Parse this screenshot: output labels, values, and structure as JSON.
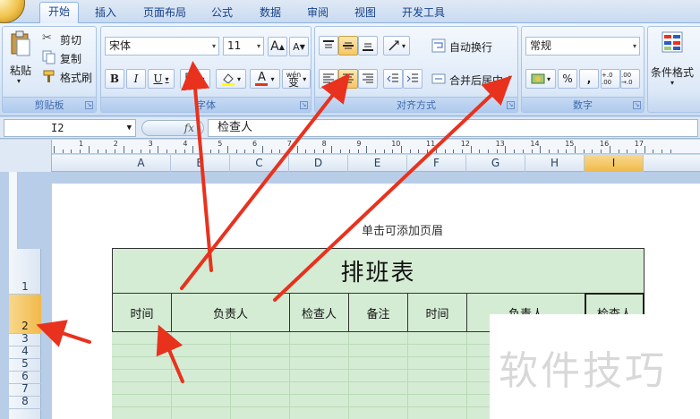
{
  "tabs": [
    {
      "label": "开始",
      "active": true
    },
    {
      "label": "插入"
    },
    {
      "label": "页面布局"
    },
    {
      "label": "公式"
    },
    {
      "label": "数据"
    },
    {
      "label": "审阅"
    },
    {
      "label": "视图"
    },
    {
      "label": "开发工具"
    }
  ],
  "clipboard": {
    "paste": "粘贴",
    "cut": "剪切",
    "copy": "复制",
    "format_painter": "格式刷",
    "group_label": "剪贴板"
  },
  "font": {
    "name": "宋体",
    "size": "11",
    "grow": "A",
    "shrink": "A",
    "bold": "B",
    "italic": "I",
    "underline": "U",
    "font_color": "A",
    "phonetic": "wén",
    "phonetic_char": "变",
    "group_label": "字体"
  },
  "alignment": {
    "wrap_text": "自动换行",
    "merge_center": "合并后居中",
    "group_label": "对齐方式"
  },
  "number": {
    "format": "常规",
    "percent": "%",
    "comma": ",",
    "inc_decimal": "+.0 .00",
    "dec_decimal": ".00 →.0",
    "group_label": "数字"
  },
  "styles": {
    "conditional": "条件格式"
  },
  "formula_bar": {
    "name_box": "I2",
    "fx": "fx",
    "value": "检查人"
  },
  "columns": [
    "A",
    "B",
    "C",
    "D",
    "E",
    "F",
    "G",
    "H",
    "I"
  ],
  "selected_column": "I",
  "rows": [
    "1",
    "2",
    "3",
    "4",
    "5",
    "6",
    "7",
    "8"
  ],
  "selected_row": "2",
  "ruler_numbers": [
    "1",
    "2",
    "3",
    "4",
    "5",
    "6",
    "7",
    "8",
    "9",
    "10",
    "11",
    "12",
    "13",
    "14",
    "15",
    "16",
    "17"
  ],
  "page_header_hint": "单击可添加页眉",
  "table": {
    "title": "排班表",
    "headers": [
      "时间",
      "负责人",
      "检查人",
      "备注",
      "时间",
      "负责人",
      "检查人"
    ]
  },
  "watermark": "软件技巧",
  "colors": {
    "accent": "#f1b94a",
    "cell_fill": "#d5ecd4",
    "arrow": "#e8321e"
  }
}
